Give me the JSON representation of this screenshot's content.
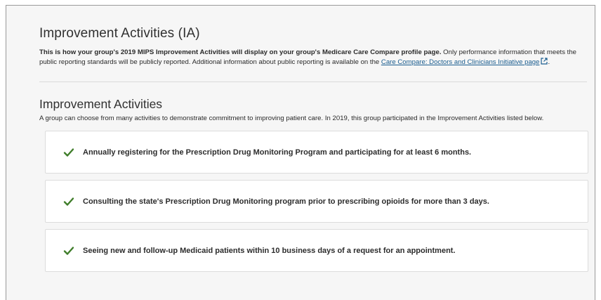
{
  "section": {
    "title": "Improvement Activities (IA)",
    "lead_bold": "This is how your group's 2019 MIPS Improvement Activities will display on your group's Medicare Care Compare profile page.",
    "lead_rest": " Only performance information that meets the public reporting standards will be publicly reported. Additional information about public reporting is available on the ",
    "lead_link": "Care Compare: Doctors and Clinicians Initiative page",
    "lead_end": "."
  },
  "activities": {
    "title": "Improvement Activities",
    "description": "A group can choose from many activities to demonstrate commitment to improving patient care. In 2019, this group participated in the Improvement Activities listed below.",
    "items": [
      {
        "label": "Annually registering for the Prescription Drug Monitoring Program and participating for at least 6 months."
      },
      {
        "label": "Consulting the state's Prescription Drug Monitoring program prior to prescribing opioids for more than 3 days."
      },
      {
        "label": "Seeing new and follow-up Medicaid patients within 10 business days of a request for an appointment."
      }
    ]
  },
  "colors": {
    "check": "#3f7d2a",
    "link": "#1a5d8f",
    "background": "#f6f6f6"
  },
  "icons": {
    "check": "check-icon",
    "external": "external-link-icon"
  }
}
